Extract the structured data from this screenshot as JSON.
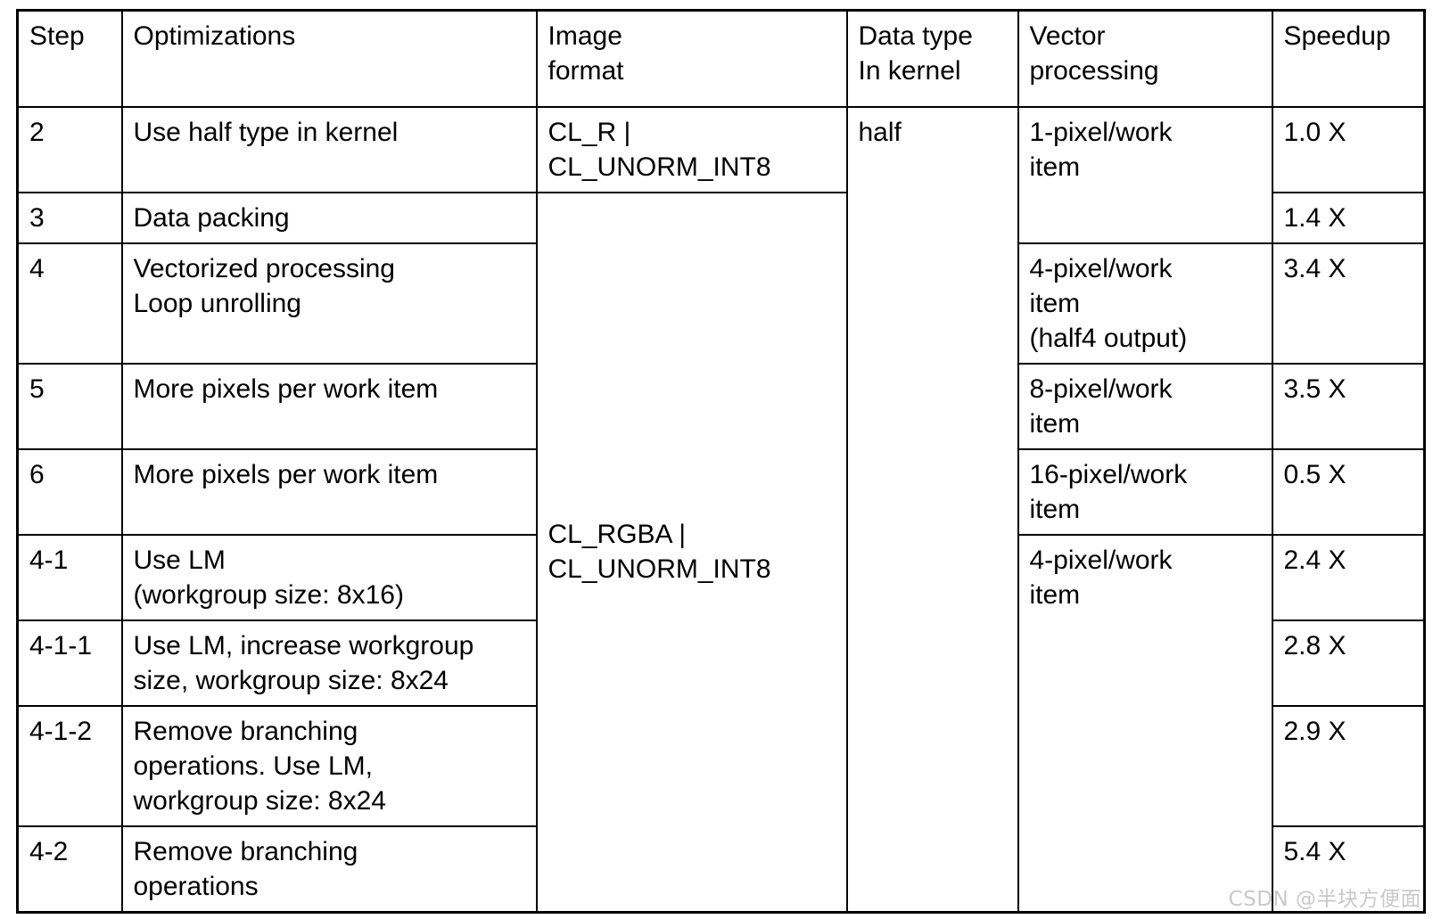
{
  "table": {
    "columns": [
      {
        "key": "step",
        "label": "Step"
      },
      {
        "key": "opt",
        "label": "Optimizations"
      },
      {
        "key": "imgfmt",
        "label_line1": "Image",
        "label_line2": "format"
      },
      {
        "key": "dtype",
        "label_line1": "Data type",
        "label_line2": "In kernel"
      },
      {
        "key": "vector",
        "label_line1": "Vector",
        "label_line2": "processing"
      },
      {
        "key": "speedup",
        "label": "Speedup"
      }
    ],
    "image_formats": {
      "fmt_r": {
        "line1": "CL_R |",
        "line2": "CL_UNORM_INT8"
      },
      "fmt_rgba": {
        "line1": "CL_RGBA |",
        "line2": "CL_UNORM_INT8"
      }
    },
    "data_type": "half",
    "vector_modes": {
      "v1": {
        "line1": "1-pixel/work",
        "line2": "item"
      },
      "v4_half4": {
        "line1": "4-pixel/work",
        "line2": "item",
        "line3": "(half4 output)"
      },
      "v8": {
        "line1": "8-pixel/work",
        "line2": "item"
      },
      "v16": {
        "line1": "16-pixel/work",
        "line2": "item"
      },
      "v4": {
        "line1": "4-pixel/work",
        "line2": "item"
      }
    },
    "rows": [
      {
        "step": "2",
        "optimization_lines": [
          "Use half type in kernel"
        ],
        "speedup": "1.0 X"
      },
      {
        "step": "3",
        "optimization_lines": [
          "Data packing"
        ],
        "speedup": "1.4 X"
      },
      {
        "step": "4",
        "optimization_lines": [
          "Vectorized processing",
          "Loop unrolling"
        ],
        "speedup": "3.4 X"
      },
      {
        "step": "5",
        "optimization_lines": [
          "More pixels per work item"
        ],
        "speedup": "3.5 X"
      },
      {
        "step": "6",
        "optimization_lines": [
          "More pixels per work item"
        ],
        "speedup": "0.5 X"
      },
      {
        "step": "4-1",
        "optimization_lines": [
          "Use LM",
          "(workgroup size: 8x16)"
        ],
        "speedup": "2.4 X"
      },
      {
        "step": "4-1-1",
        "optimization_lines": [
          "Use LM, increase workgroup",
          "size, workgroup size: 8x24"
        ],
        "speedup": "2.8 X"
      },
      {
        "step": "4-1-2",
        "optimization_lines": [
          "Remove branching",
          "operations. Use LM,",
          "workgroup size: 8x24"
        ],
        "speedup": "2.9 X"
      },
      {
        "step": "4-2",
        "optimization_lines": [
          "Remove branching",
          "operations"
        ],
        "speedup": "5.4 X"
      }
    ]
  },
  "watermark": "CSDN @半块方便面"
}
